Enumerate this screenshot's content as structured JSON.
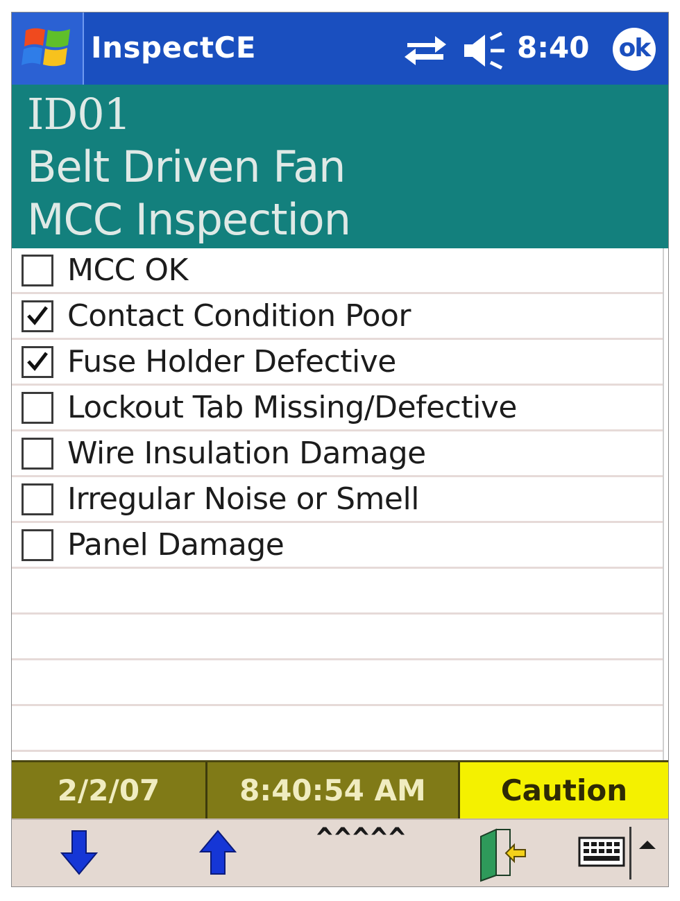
{
  "titlebar": {
    "app_title": "InspectCE",
    "clock": "8:40",
    "ok_label": "ok"
  },
  "header": {
    "id": "ID01",
    "equipment": "Belt Driven Fan",
    "inspection": "MCC Inspection"
  },
  "checklist": {
    "items": [
      {
        "label": "MCC OK",
        "checked": false
      },
      {
        "label": "Contact Condition Poor",
        "checked": true
      },
      {
        "label": "Fuse Holder Defective",
        "checked": true
      },
      {
        "label": "Lockout Tab Missing/Defective",
        "checked": false
      },
      {
        "label": "Wire Insulation Damage",
        "checked": false
      },
      {
        "label": "Irregular Noise or Smell",
        "checked": false
      },
      {
        "label": "Panel Damage",
        "checked": false
      }
    ]
  },
  "statusbar": {
    "date": "2/2/07",
    "time": "8:40:54 AM",
    "status": "Caution"
  },
  "toolbar": {
    "carets": "^^^^^",
    "icons": [
      "arrow-down-icon",
      "arrow-up-icon",
      "exit-door-icon",
      "keyboard-icon",
      "caret-up-icon"
    ]
  },
  "colors": {
    "titlebar": "#1a4fbf",
    "header": "#13807d",
    "statusbar": "#807a17",
    "caution": "#f4f100",
    "toolbar": "#e4d9d2",
    "arrows": "#1536d6"
  }
}
